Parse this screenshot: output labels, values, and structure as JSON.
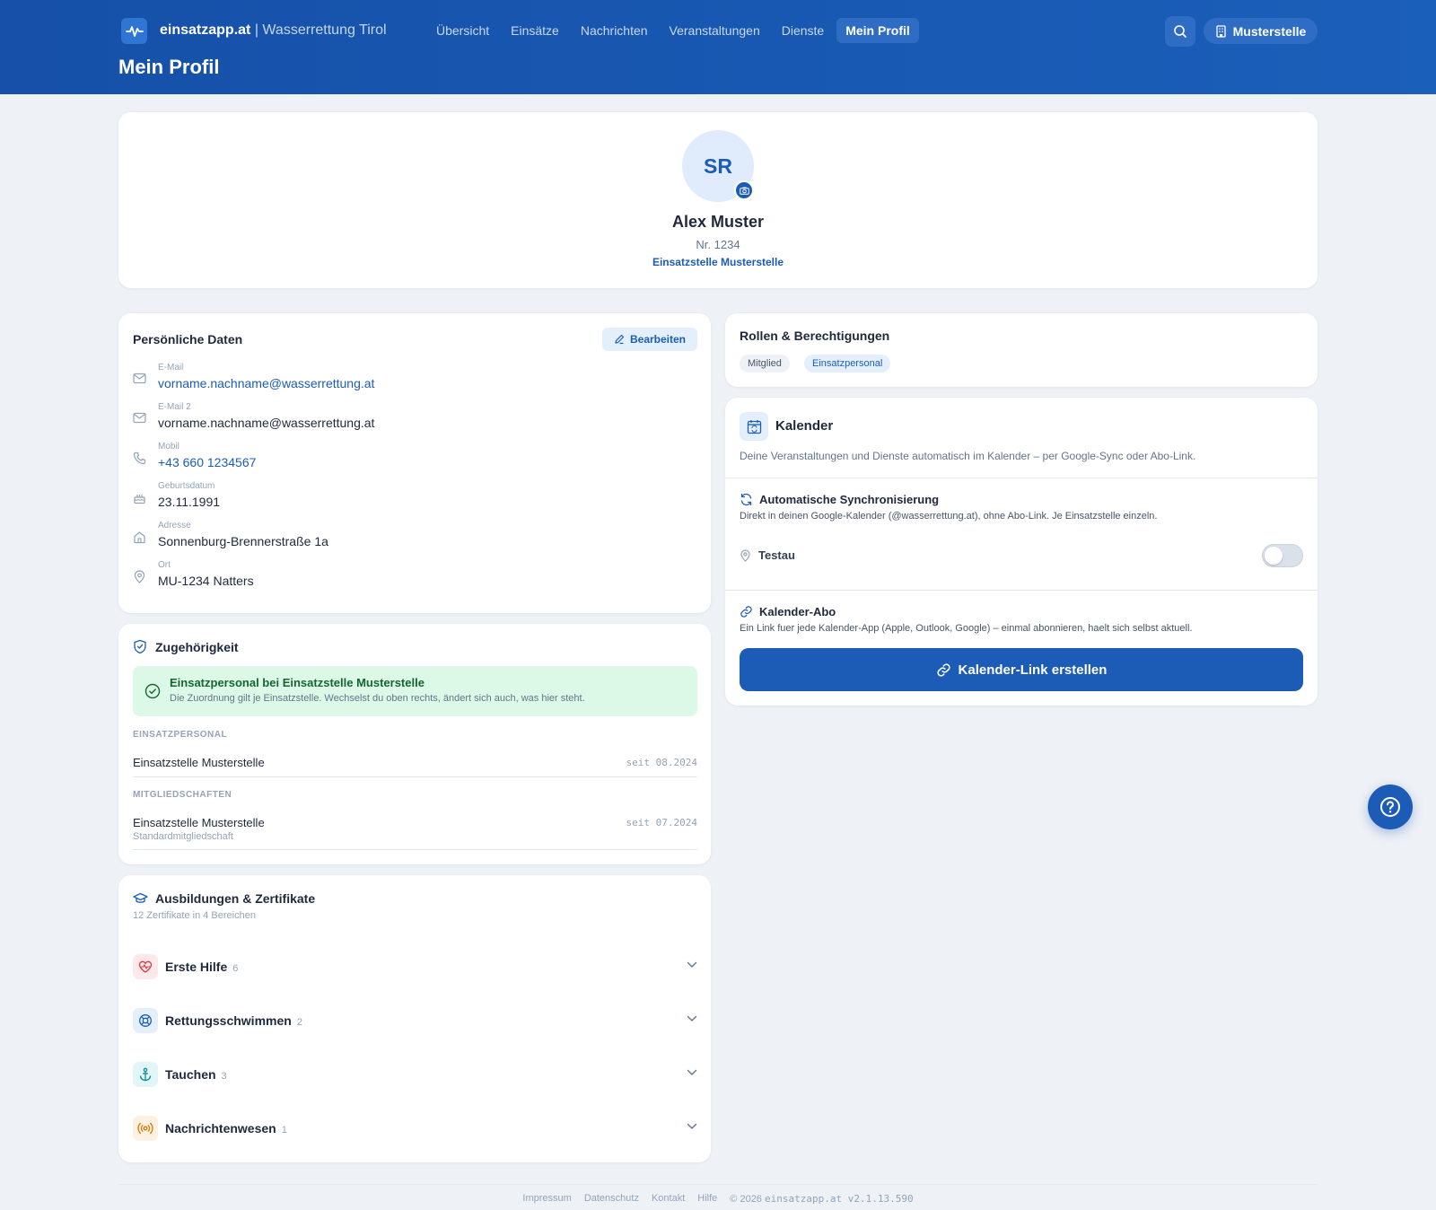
{
  "app": {
    "name": "einsatzapp.at",
    "separator": "|",
    "org": "Wasserrettung Tirol"
  },
  "nav": {
    "items": [
      {
        "label": "Übersicht",
        "active": false
      },
      {
        "label": "Einsätze",
        "active": false
      },
      {
        "label": "Nachrichten",
        "active": false
      },
      {
        "label": "Veranstaltungen",
        "active": false
      },
      {
        "label": "Dienste",
        "active": false
      },
      {
        "label": "Mein Profil",
        "active": true
      }
    ]
  },
  "header": {
    "station_button": "Musterstelle",
    "page_title": "Mein Profil"
  },
  "profile": {
    "initials": "SR",
    "name": "Alex Muster",
    "number": "Nr. 1234",
    "station": "Einsatzstelle Musterstelle"
  },
  "personal": {
    "title": "Persönliche Daten",
    "edit_label": "Bearbeiten",
    "fields": [
      {
        "label": "E-Mail",
        "value": "vorname.nachname@wasserrettung.at",
        "icon": "mail-icon"
      },
      {
        "label": "E-Mail 2",
        "value": "vorname.nachname@wasserrettung.at",
        "icon": "mail-icon"
      },
      {
        "label": "Mobil",
        "value": "+43 660 1234567",
        "icon": "phone-icon"
      },
      {
        "label": "Geburtsdatum",
        "value": "23.11.1991",
        "icon": "cake-icon"
      },
      {
        "label": "Adresse",
        "value": "Sonnenburg-Brennerstraße 1a",
        "icon": "home-icon"
      },
      {
        "label": "Ort",
        "value": "MU-1234 Natters",
        "icon": "map-pin-icon"
      }
    ]
  },
  "membership": {
    "title": "Zugehörigkeit",
    "status_title": "Einsatzpersonal bei Einsatzstelle Musterstelle",
    "status_desc": "Die Zuordnung gilt je Einsatzstelle. Wechselst du oben rechts, ändert sich auch, was hier steht.",
    "section1": "EINSATZPERSONAL",
    "row1": {
      "name": "Einsatzstelle Musterstelle",
      "since": "seit 08.2024"
    },
    "section2": "MITGLIEDSCHAFTEN",
    "row2": {
      "name": "Einsatzstelle Musterstelle",
      "sub": "Standardmitgliedschaft",
      "since": "seit 07.2024"
    }
  },
  "training": {
    "title": "Ausbildungen & Zertifikate",
    "subtitle": "12 Zertifikate in 4 Bereichen",
    "groups": [
      {
        "name": "Erste Hilfe",
        "count": "6",
        "icon": "heart-pulse-icon"
      },
      {
        "name": "Rettungsschwimmen",
        "count": "2",
        "icon": "lifebuoy-icon"
      },
      {
        "name": "Tauchen",
        "count": "3",
        "icon": "anchor-icon"
      },
      {
        "name": "Nachrichtenwesen",
        "count": "1",
        "icon": "radio-icon"
      }
    ]
  },
  "roles": {
    "title": "Rollen & Berechtigungen",
    "badges": [
      "Mitglied",
      "Einsatzpersonal"
    ]
  },
  "calendar": {
    "title": "Kalender",
    "desc": "Deine Veranstaltungen und Dienste automatisch im Kalender – per Google-Sync oder Abo-Link.",
    "sync_title": "Automatische Synchronisierung",
    "sync_desc": "Direkt in deinen Google-Kalender (@wasserrettung.at), ohne Abo-Link. Je Einsatzstelle einzeln.",
    "station": "Testau",
    "sync_enabled": false,
    "abo_title": "Kalender-Abo",
    "abo_desc": "Ein Link fuer jede Kalender-App (Apple, Outlook, Google) – einmal abonnieren, haelt sich selbst aktuell.",
    "button": "Kalender-Link erstellen"
  },
  "footer": {
    "links": [
      "Impressum",
      "Datenschutz",
      "Kontakt",
      "Hilfe"
    ],
    "copyright": "© 2026",
    "version": "einsatzapp.at v2.1.13.590"
  },
  "colors": {
    "primary": "#1c5cb6",
    "header": "#1650a8",
    "success_bg": "#dcf8e6",
    "success_text": "#166534",
    "background": "#eef1f6"
  }
}
